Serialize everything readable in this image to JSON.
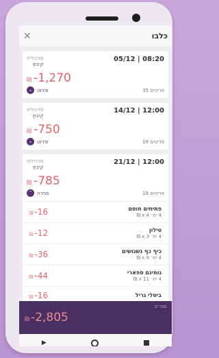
{
  "header": {
    "title": "כלבו",
    "close_icon": "close-icon"
  },
  "purchases": [
    {
      "datetime": "05/12 | 08:20",
      "store_type": "מרכולית",
      "store_name": "קיבוץ",
      "amount": "-1,270",
      "currency": "₪",
      "items": "35 פריטים",
      "toggle_label": "פירוט",
      "expanded": false
    },
    {
      "datetime": "14/12 | 12:00",
      "store_type": "מרכולית",
      "store_name": "קיבוץ",
      "amount": "-750",
      "currency": "₪",
      "items": "18 פריטים",
      "toggle_label": "פירוט",
      "expanded": false
    },
    {
      "datetime": "21/12 | 12:00",
      "store_type": "מרכולית",
      "store_name": "קיבוץ",
      "amount": "-785",
      "currency": "₪",
      "items": "18 פריטים",
      "toggle_label": "סגירה",
      "expanded": true
    }
  ],
  "line_items": [
    {
      "name": "פתיתים חוסם",
      "qty": "4 יח׳ x 4 ₪",
      "price": "-16",
      "currency": "₪"
    },
    {
      "name": "טילון",
      "qty": "4 יח׳ x 3 ₪",
      "price": "-12",
      "currency": "₪"
    },
    {
      "name": "כיף כף נשנושים",
      "qty": "4 יח׳ x 9 ₪",
      "price": "-36",
      "currency": "₪"
    },
    {
      "name": "גומיגם ספארי",
      "qty": "4 יח׳ x 11 ₪",
      "price": "-44",
      "currency": "₪"
    },
    {
      "name": "ביסלי גריל",
      "qty": "",
      "price": "-16",
      "currency": "₪"
    }
  ],
  "total": {
    "label": "סה״כ",
    "value": "-2,805",
    "currency": "₪"
  },
  "navbar": {
    "back": "▶",
    "home": "home",
    "recent": "recent"
  },
  "colors": {
    "accent": "#4a2f63",
    "negative": "#e8606a",
    "background": "#c9a7dc"
  }
}
